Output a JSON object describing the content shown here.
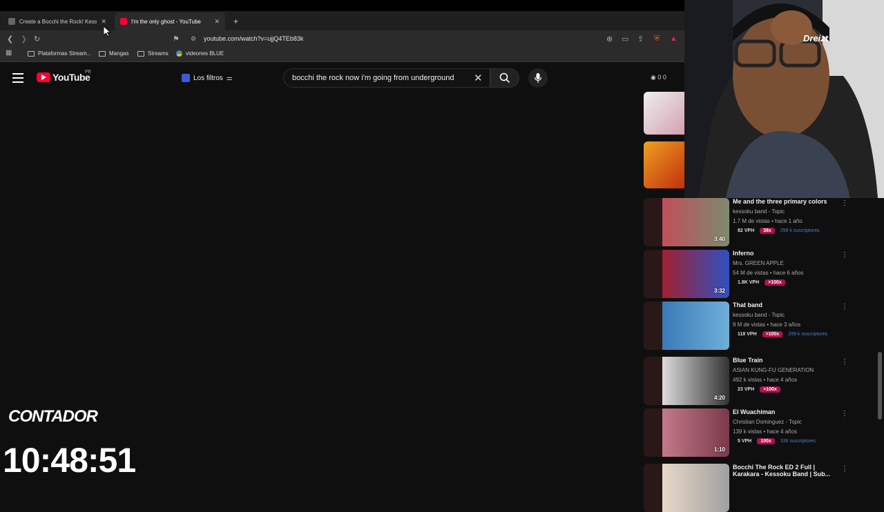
{
  "browser": {
    "tabs": [
      {
        "label": "Create a Bocchi the Rock! Kessok",
        "active": false
      },
      {
        "label": "I'm the only ghost - YouTube",
        "active": true
      }
    ],
    "url": "youtube.com/watch?v=ujjQ4TEb83k",
    "bookmarks": [
      "Plataformas Stream...",
      "Mangas",
      "Streams",
      "videones BLUE"
    ]
  },
  "youtube": {
    "logo": "YouTube",
    "region": "PE",
    "filters_label": "Los filtros",
    "search_value": "bocchi the rock now i'm going from underground",
    "counters": "0  0",
    "videos": [
      {
        "title": "Me and the three primary colors",
        "channel": "kessoku band - Topic",
        "meta": "1.7 M de vistas • hace 1 año",
        "duration": "3:40",
        "vph": "82 VPH",
        "ratio": "38x",
        "subs": "299 k suscriptores",
        "colors": [
          "#c04f5a",
          "#7d8a6f"
        ]
      },
      {
        "title": "Inferno",
        "channel": "Mrs. GREEN APPLE",
        "meta": "54 M de vistas • hace 6 años",
        "duration": "3:32",
        "vph": "1.8K VPH",
        "ratio": ">100x",
        "subs": "",
        "colors": [
          "#a02030",
          "#3050c0"
        ]
      },
      {
        "title": "That band",
        "channel": "kessoku band - Topic",
        "meta": "9 M de vistas • hace 3 años",
        "duration": "",
        "vph": "118 VPH",
        "ratio": ">100x",
        "subs": "299 k suscriptores",
        "colors": [
          "#3a7ab8",
          "#6fb0d8"
        ]
      },
      {
        "title": "Blue Train",
        "channel": "ASIAN KUNG-FU GENERATION",
        "meta": "492 k vistas • hace 4 años",
        "duration": "4:20",
        "vph": "23 VPH",
        "ratio": ">100x",
        "subs": "",
        "colors": [
          "#dcdcdc",
          "#333333"
        ]
      },
      {
        "title": "El Wuachiman",
        "channel": "Christian Dominguez - Topic",
        "meta": "139 k vistas • hace 4 años",
        "duration": "1:10",
        "vph": "5 VPH",
        "ratio": "100x",
        "subs": "336 suscriptores",
        "colors": [
          "#c27a8a",
          "#7a3a4a"
        ]
      },
      {
        "title": "Bocchi The Rock ED 2 Full | Karakara - Kessoku Band | Sub...",
        "channel": "",
        "meta": "",
        "duration": "",
        "vph": "",
        "ratio": "",
        "subs": "",
        "colors": [
          "#e8d8c8",
          "#a0a0a0"
        ]
      }
    ]
  },
  "overlay": {
    "label": "CONTADOR",
    "timer": "10:48:51"
  },
  "webcam": {
    "name_text": "Dreizt"
  }
}
